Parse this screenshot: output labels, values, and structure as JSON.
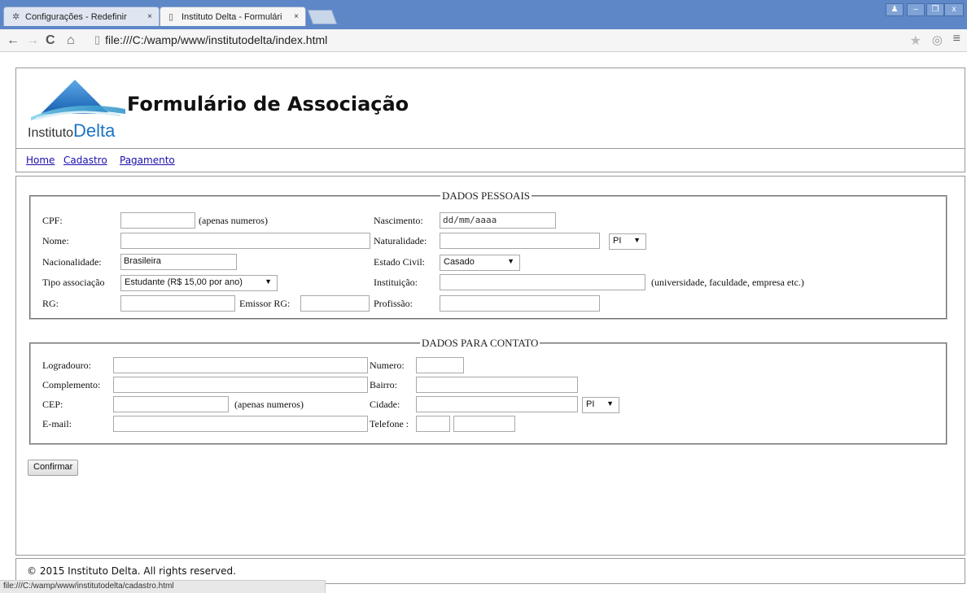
{
  "browser": {
    "tabs": [
      {
        "label": "Configurações - Redefinir",
        "icon": "gear-icon"
      },
      {
        "label": "Instituto Delta - Formulári",
        "icon": "page-icon"
      }
    ],
    "close_glyph": "×",
    "url": "file:///C:/wamp/www/institutodelta/index.html",
    "status_url": "file:///C:/wamp/www/institutodelta/cadastro.html"
  },
  "header": {
    "logo_text_prefix": "Instituto",
    "logo_text_brand": "Delta",
    "title": "Formulário de Associação"
  },
  "nav": {
    "items": [
      "Home",
      "Cadastro",
      "Pagamento"
    ]
  },
  "pessoais": {
    "legend": "DADOS PESSOAIS",
    "cpf_label": "CPF:",
    "cpf_hint": "(apenas numeros)",
    "nascimento_label": "Nascimento:",
    "nascimento_placeholder": "dd/mm/aaaa",
    "nome_label": "Nome:",
    "naturalidade_label": "Naturalidade:",
    "naturalidade_uf": "PI",
    "nacionalidade_label": "Nacionalidade:",
    "nacionalidade_value": "Brasileira",
    "estado_civil_label": "Estado Civil:",
    "estado_civil_value": "Casado",
    "tipo_label": "Tipo associação",
    "tipo_value": "Estudante (R$ 15,00 por ano)",
    "instituicao_label": "Instituição:",
    "instituicao_hint": "(universidade, faculdade, empresa etc.)",
    "rg_label": "RG:",
    "emissor_label": "Emissor RG:",
    "profissao_label": "Profissão:"
  },
  "contato": {
    "legend": "DADOS PARA CONTATO",
    "logradouro_label": "Logradouro:",
    "numero_label": "Numero:",
    "complemento_label": "Complemento:",
    "bairro_label": "Bairro:",
    "cep_label": "CEP:",
    "cep_hint": "(apenas numeros)",
    "cidade_label": "Cidade:",
    "cidade_uf": "PI",
    "email_label": "E-mail:",
    "telefone_label": "Telefone :"
  },
  "confirm_label": "Confirmar",
  "footer": "© 2015 Instituto Delta. All rights reserved."
}
